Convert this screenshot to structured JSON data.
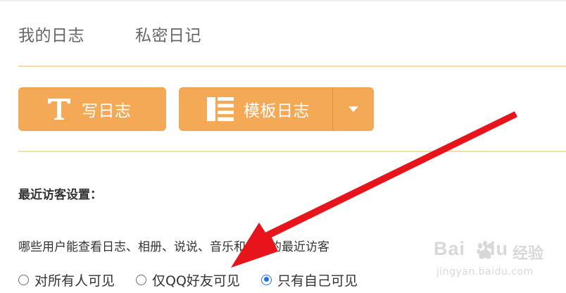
{
  "tabs": [
    {
      "label": "我的日志"
    },
    {
      "label": "私密日记"
    }
  ],
  "toolbar": {
    "write_label": "写日志",
    "template_label": "模板日志"
  },
  "settings": {
    "title": "最近访客设置：",
    "description": "哪些用户能查看日志、相册、说说、音乐和视频的最近访客",
    "options": [
      {
        "label": "对所有人可见",
        "checked": false
      },
      {
        "label": "仅QQ好友可见",
        "checked": false
      },
      {
        "label": "只有自己可见",
        "checked": true
      }
    ]
  },
  "watermark": {
    "brand": "Bai",
    "brand_suffix": "du",
    "sub": "经验",
    "url": "jingyan.baidu.com"
  },
  "colors": {
    "button_bg": "#f3a955",
    "divider": "#f6dca8",
    "radio_checked": "#1a73e8",
    "annotation_arrow": "#e8141c"
  },
  "icons": {
    "write": "text-t-icon",
    "template": "list-icon",
    "dropdown": "caret-down-icon",
    "annotation": "red-arrow"
  }
}
